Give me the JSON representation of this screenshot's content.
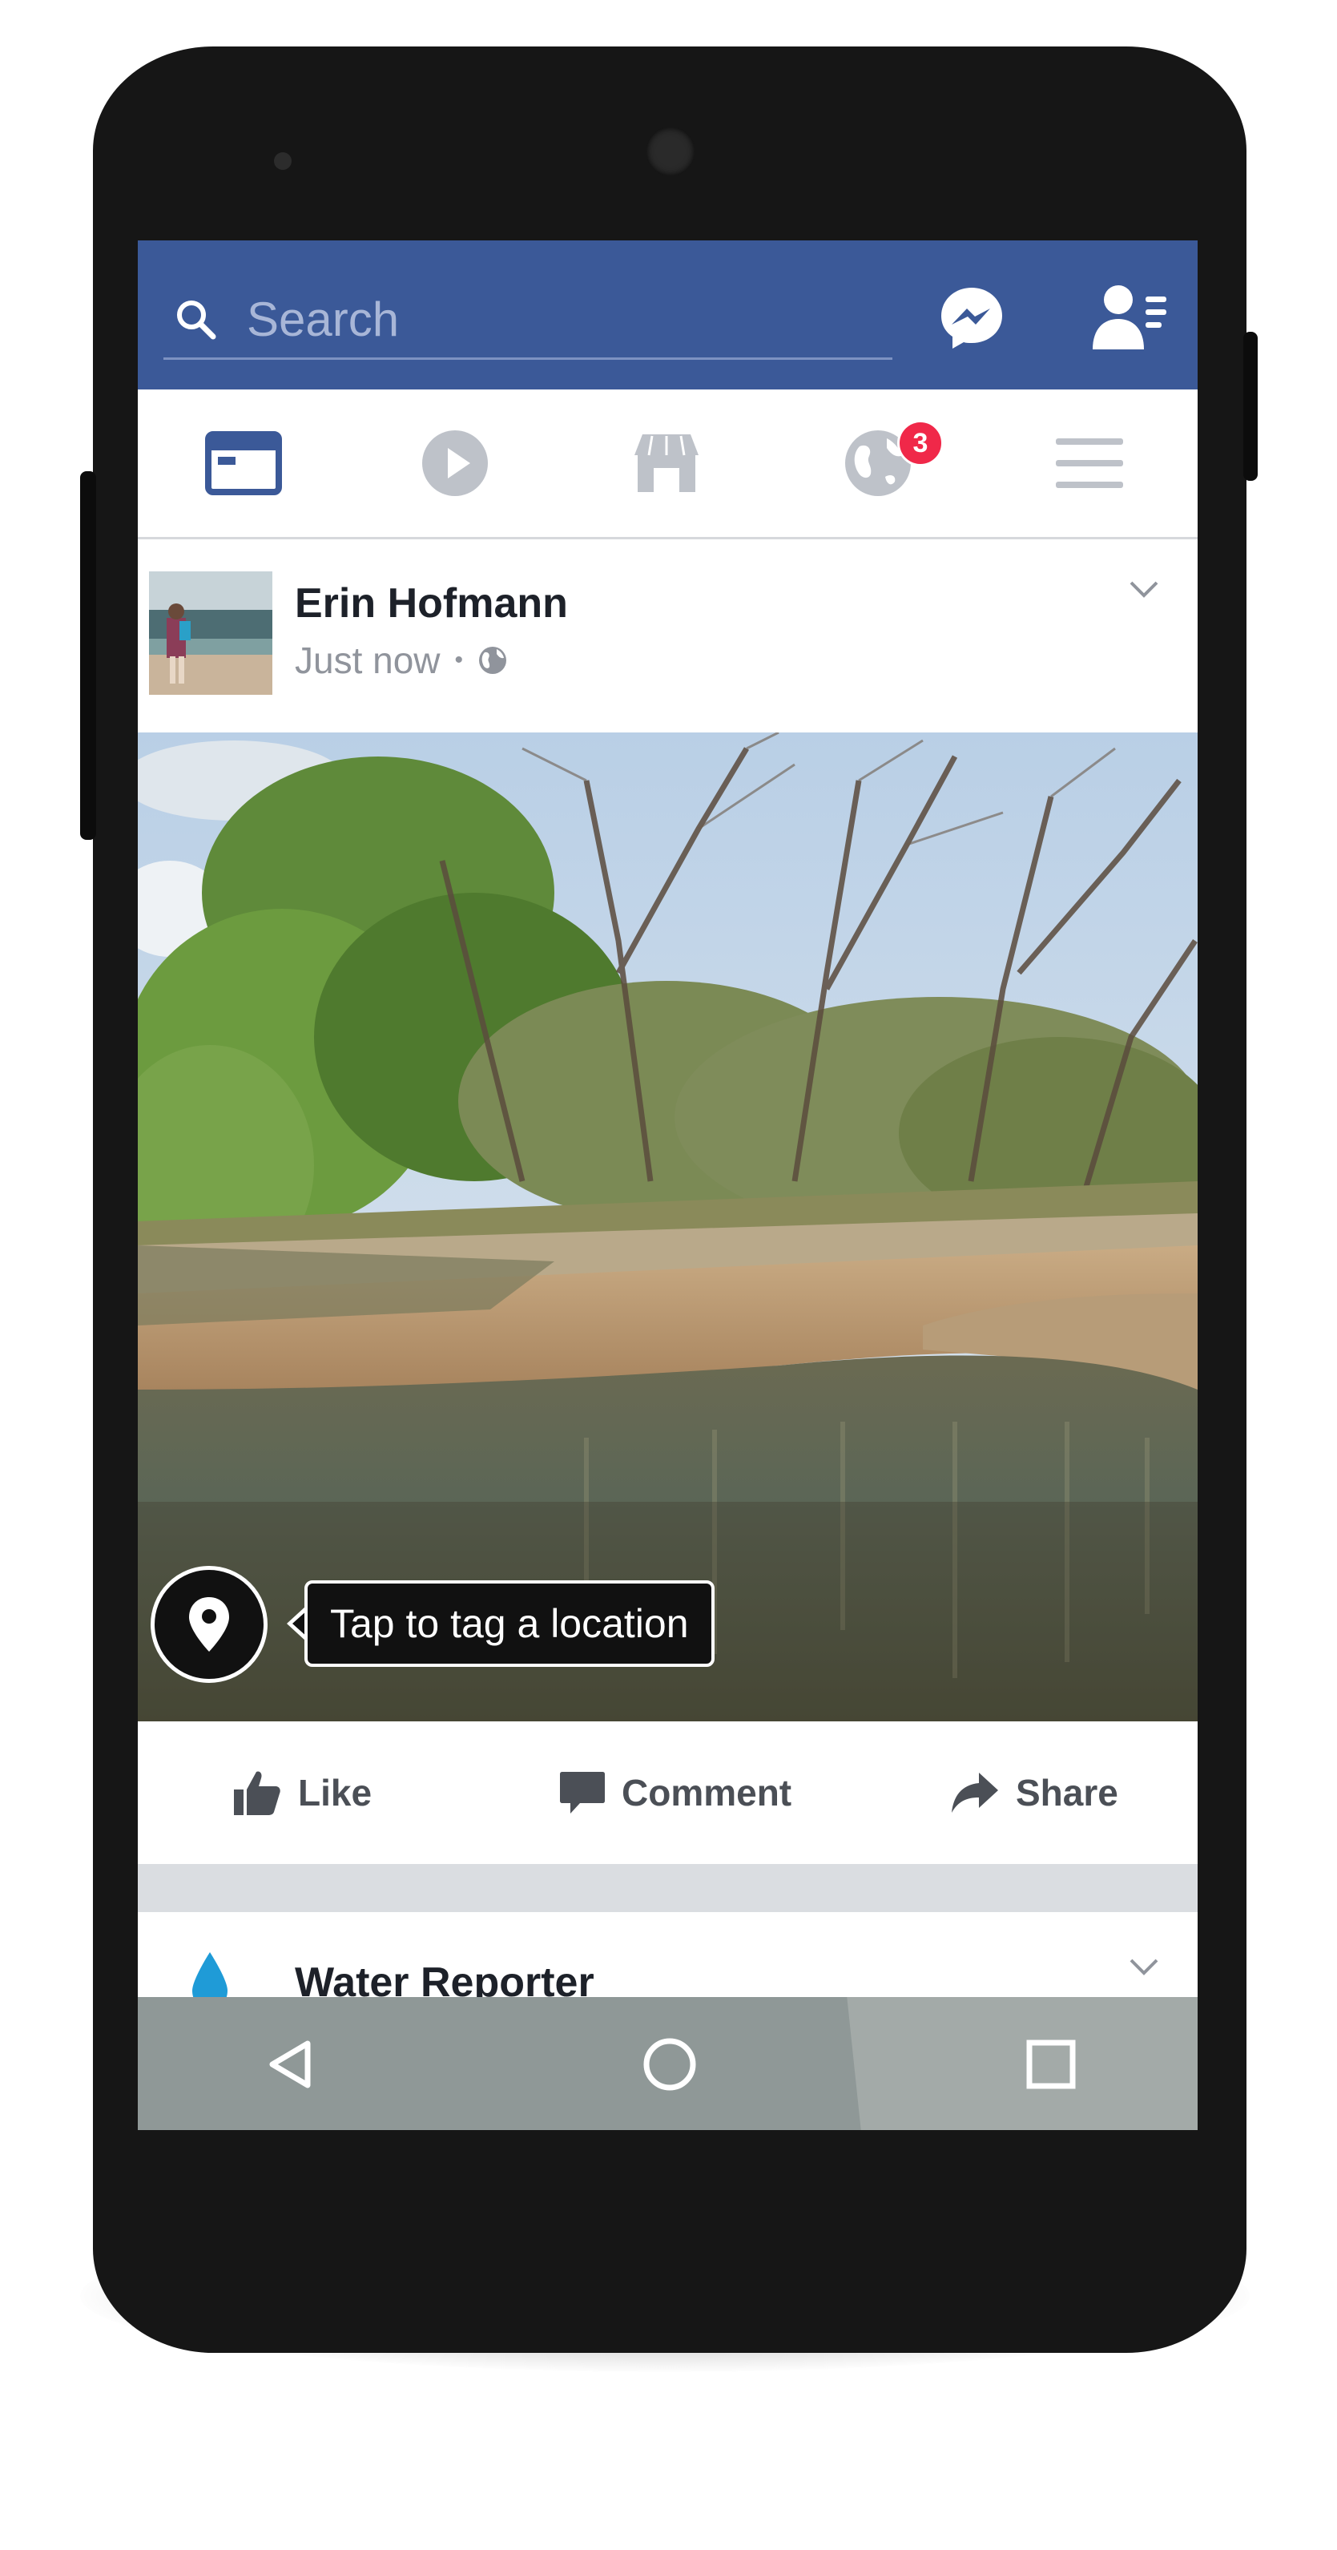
{
  "header": {
    "search_placeholder": "Search"
  },
  "nav": {
    "tabs": [
      {
        "name": "news-feed",
        "active": true
      },
      {
        "name": "watch",
        "active": false
      },
      {
        "name": "marketplace",
        "active": false
      },
      {
        "name": "notifications",
        "active": false,
        "badge": "3"
      },
      {
        "name": "menu",
        "active": false
      }
    ],
    "notifications_badge": "3"
  },
  "post": {
    "author": "Erin Hofmann",
    "timestamp": "Just now",
    "separator": "•",
    "privacy_icon": "globe-icon",
    "location_tooltip": "Tap to tag a location",
    "actions": {
      "like": "Like",
      "comment": "Comment",
      "share": "Share"
    }
  },
  "next_post": {
    "author": "Water Reporter"
  },
  "colors": {
    "header_blue": "#3b5998",
    "inactive_icon": "#bec2c9",
    "badge_red": "#f02849",
    "water_drop": "#1f9bd7"
  }
}
